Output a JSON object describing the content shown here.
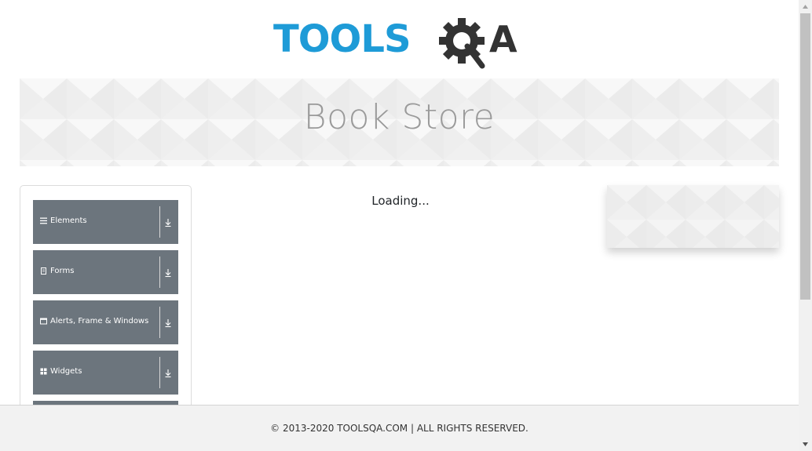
{
  "brand": {
    "logo_text_blue": "TOOLS",
    "logo_text_dark": "QA",
    "blue": "#1e9bd7",
    "dark": "#333333"
  },
  "banner": {
    "title": "Book Store"
  },
  "sidebar": {
    "groups": [
      {
        "label": "Elements",
        "icon": "menu-lines-icon"
      },
      {
        "label": "Forms",
        "icon": "document-icon"
      },
      {
        "label": "Alerts, Frame & Windows",
        "icon": "window-icon"
      },
      {
        "label": "Widgets",
        "icon": "grid-icon"
      }
    ]
  },
  "main": {
    "status_text": "Loading..."
  },
  "footer": {
    "text": "© 2013-2020 TOOLSQA.COM | ALL RIGHTS RESERVED."
  },
  "colors": {
    "group_bg": "#6c757d",
    "footer_bg": "#f2f2f2",
    "banner_title": "#9a9a9a"
  }
}
